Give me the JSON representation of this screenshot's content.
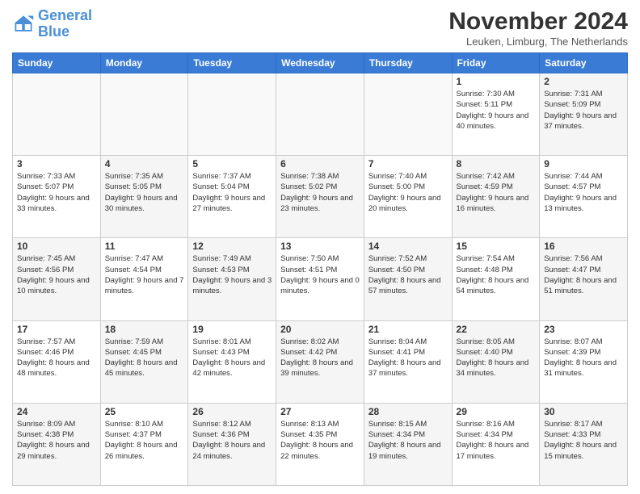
{
  "logo": {
    "line1": "General",
    "line2": "Blue"
  },
  "header": {
    "month": "November 2024",
    "location": "Leuken, Limburg, The Netherlands"
  },
  "weekdays": [
    "Sunday",
    "Monday",
    "Tuesday",
    "Wednesday",
    "Thursday",
    "Friday",
    "Saturday"
  ],
  "weeks": [
    [
      {
        "day": "",
        "info": "",
        "empty": true
      },
      {
        "day": "",
        "info": "",
        "empty": true
      },
      {
        "day": "",
        "info": "",
        "empty": true
      },
      {
        "day": "",
        "info": "",
        "empty": true
      },
      {
        "day": "",
        "info": "",
        "empty": true
      },
      {
        "day": "1",
        "info": "Sunrise: 7:30 AM\nSunset: 5:11 PM\nDaylight: 9 hours and 40 minutes."
      },
      {
        "day": "2",
        "info": "Sunrise: 7:31 AM\nSunset: 5:09 PM\nDaylight: 9 hours and 37 minutes."
      }
    ],
    [
      {
        "day": "3",
        "info": "Sunrise: 7:33 AM\nSunset: 5:07 PM\nDaylight: 9 hours and 33 minutes."
      },
      {
        "day": "4",
        "info": "Sunrise: 7:35 AM\nSunset: 5:05 PM\nDaylight: 9 hours and 30 minutes."
      },
      {
        "day": "5",
        "info": "Sunrise: 7:37 AM\nSunset: 5:04 PM\nDaylight: 9 hours and 27 minutes."
      },
      {
        "day": "6",
        "info": "Sunrise: 7:38 AM\nSunset: 5:02 PM\nDaylight: 9 hours and 23 minutes."
      },
      {
        "day": "7",
        "info": "Sunrise: 7:40 AM\nSunset: 5:00 PM\nDaylight: 9 hours and 20 minutes."
      },
      {
        "day": "8",
        "info": "Sunrise: 7:42 AM\nSunset: 4:59 PM\nDaylight: 9 hours and 16 minutes."
      },
      {
        "day": "9",
        "info": "Sunrise: 7:44 AM\nSunset: 4:57 PM\nDaylight: 9 hours and 13 minutes."
      }
    ],
    [
      {
        "day": "10",
        "info": "Sunrise: 7:45 AM\nSunset: 4:56 PM\nDaylight: 9 hours and 10 minutes."
      },
      {
        "day": "11",
        "info": "Sunrise: 7:47 AM\nSunset: 4:54 PM\nDaylight: 9 hours and 7 minutes."
      },
      {
        "day": "12",
        "info": "Sunrise: 7:49 AM\nSunset: 4:53 PM\nDaylight: 9 hours and 3 minutes."
      },
      {
        "day": "13",
        "info": "Sunrise: 7:50 AM\nSunset: 4:51 PM\nDaylight: 9 hours and 0 minutes."
      },
      {
        "day": "14",
        "info": "Sunrise: 7:52 AM\nSunset: 4:50 PM\nDaylight: 8 hours and 57 minutes."
      },
      {
        "day": "15",
        "info": "Sunrise: 7:54 AM\nSunset: 4:48 PM\nDaylight: 8 hours and 54 minutes."
      },
      {
        "day": "16",
        "info": "Sunrise: 7:56 AM\nSunset: 4:47 PM\nDaylight: 8 hours and 51 minutes."
      }
    ],
    [
      {
        "day": "17",
        "info": "Sunrise: 7:57 AM\nSunset: 4:46 PM\nDaylight: 8 hours and 48 minutes."
      },
      {
        "day": "18",
        "info": "Sunrise: 7:59 AM\nSunset: 4:45 PM\nDaylight: 8 hours and 45 minutes."
      },
      {
        "day": "19",
        "info": "Sunrise: 8:01 AM\nSunset: 4:43 PM\nDaylight: 8 hours and 42 minutes."
      },
      {
        "day": "20",
        "info": "Sunrise: 8:02 AM\nSunset: 4:42 PM\nDaylight: 8 hours and 39 minutes."
      },
      {
        "day": "21",
        "info": "Sunrise: 8:04 AM\nSunset: 4:41 PM\nDaylight: 8 hours and 37 minutes."
      },
      {
        "day": "22",
        "info": "Sunrise: 8:05 AM\nSunset: 4:40 PM\nDaylight: 8 hours and 34 minutes."
      },
      {
        "day": "23",
        "info": "Sunrise: 8:07 AM\nSunset: 4:39 PM\nDaylight: 8 hours and 31 minutes."
      }
    ],
    [
      {
        "day": "24",
        "info": "Sunrise: 8:09 AM\nSunset: 4:38 PM\nDaylight: 8 hours and 29 minutes."
      },
      {
        "day": "25",
        "info": "Sunrise: 8:10 AM\nSunset: 4:37 PM\nDaylight: 8 hours and 26 minutes."
      },
      {
        "day": "26",
        "info": "Sunrise: 8:12 AM\nSunset: 4:36 PM\nDaylight: 8 hours and 24 minutes."
      },
      {
        "day": "27",
        "info": "Sunrise: 8:13 AM\nSunset: 4:35 PM\nDaylight: 8 hours and 22 minutes."
      },
      {
        "day": "28",
        "info": "Sunrise: 8:15 AM\nSunset: 4:34 PM\nDaylight: 8 hours and 19 minutes."
      },
      {
        "day": "29",
        "info": "Sunrise: 8:16 AM\nSunset: 4:34 PM\nDaylight: 8 hours and 17 minutes."
      },
      {
        "day": "30",
        "info": "Sunrise: 8:17 AM\nSunset: 4:33 PM\nDaylight: 8 hours and 15 minutes."
      }
    ]
  ]
}
